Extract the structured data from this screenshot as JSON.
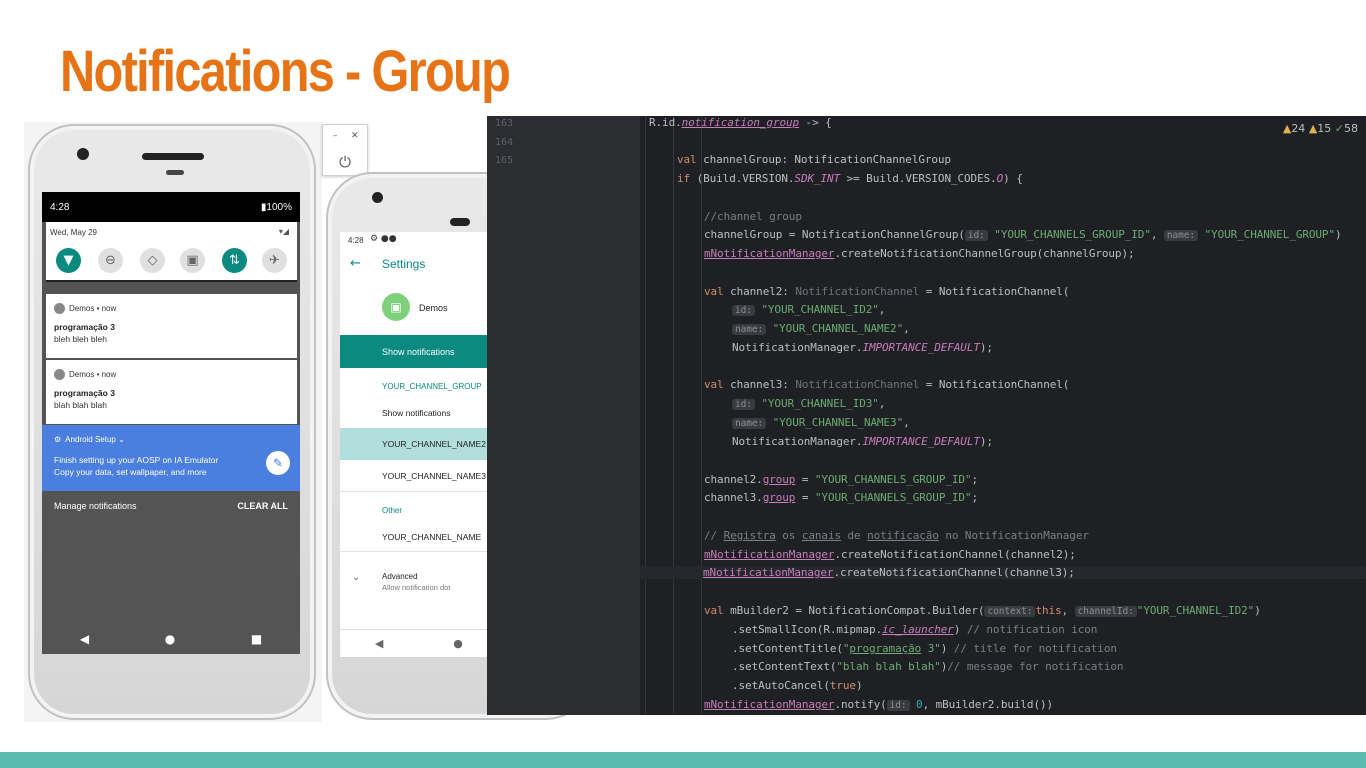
{
  "slide": {
    "title": "Notifications - Group",
    "colors": {
      "title": "#e67417",
      "bottom_bar": "#5bbbb0"
    }
  },
  "phone1": {
    "time": "4:28",
    "battery": "100%",
    "date": "Wed, May 29",
    "notifications": [
      {
        "app": "Demos • now",
        "title": "programação 3",
        "body": "bleh bleh bleh"
      },
      {
        "app": "Demos • now",
        "title": "programação 3",
        "body": "blah blah blah"
      }
    ],
    "setup": {
      "app": "Android Setup ⌄",
      "title": "Finish setting up your AOSP on IA Emulator",
      "body": "Copy your data, set wallpaper, and more"
    },
    "manage": "Manage notifications",
    "clear_all": "CLEAR ALL"
  },
  "phone2": {
    "time": "4:28",
    "title": "Settings",
    "app_name": "Demos",
    "show_notifications_header": "Show notifications",
    "group_header": "YOUR_CHANNEL_GROUP",
    "group_show": "Show notifications",
    "channel2": "YOUR_CHANNEL_NAME2",
    "channel3": "YOUR_CHANNEL_NAME3",
    "other_header": "Other",
    "channel": "YOUR_CHANNEL_NAME",
    "advanced": "Advanced",
    "advanced_sub": "Allow notification dot",
    "accent": "#0a8a80"
  },
  "editor": {
    "line_numbers": [
      "163",
      "164",
      "165"
    ],
    "warnings": {
      "warn_a": "24",
      "warn_b": "15",
      "ok": "58"
    },
    "code": {
      "l1a": "R.id.",
      "l1b": "notification_group",
      "l1c": " -> {",
      "l2a": "val ",
      "l2b": "channelGroup: NotificationChannelGroup",
      "l3a": "if ",
      "l3b": "(Build.VERSION.",
      "l3c": "SDK_INT",
      "l3d": " >= Build.VERSION_CODES.",
      "l3e": "O",
      "l3f": ") {",
      "l4": "//channel group",
      "l5a": "channelGroup = NotificationChannelGroup(",
      "l5h1": "id:",
      "l5b": "\"YOUR_CHANNELS_GROUP_ID\"",
      "l5c": ", ",
      "l5h2": "name:",
      "l5d": "\"YOUR_CHANNEL_GROUP\"",
      "l5e": ")",
      "l6a": "mNotificationManager",
      "l6b": ".createNotificationChannelGroup(channelGroup);",
      "l7a": "val ",
      "l7b": "channel2: ",
      "l7c": "NotificationChannel",
      "l7d": " = NotificationChannel(",
      "l8h": "id:",
      "l8b": "\"YOUR_CHANNEL_ID2\"",
      "l8c": ",",
      "l9h": "name:",
      "l9b": "\"YOUR_CHANNEL_NAME2\"",
      "l9c": ",",
      "l10a": "NotificationManager.",
      "l10b": "IMPORTANCE_DEFAULT",
      "l10c": ");",
      "l11a": "val ",
      "l11b": "channel3: ",
      "l11c": "NotificationChannel",
      "l11d": " = NotificationChannel(",
      "l12h": "id:",
      "l12b": "\"YOUR_CHANNEL_ID3\"",
      "l12c": ",",
      "l13h": "name:",
      "l13b": "\"YOUR_CHANNEL_NAME3\"",
      "l13c": ",",
      "l14a": "NotificationManager.",
      "l14b": "IMPORTANCE_DEFAULT",
      "l14c": ");",
      "l15a": "channel2.",
      "l15b": "group",
      "l15c": " = ",
      "l15d": "\"YOUR_CHANNELS_GROUP_ID\"",
      "l15e": ";",
      "l16a": "channel3.",
      "l16b": "group",
      "l16c": " = ",
      "l16d": "\"YOUR_CHANNELS_GROUP_ID\"",
      "l16e": ";",
      "l17a": "// ",
      "l17b": "Registra",
      "l17c": " os ",
      "l17d": "canais",
      "l17e": " de ",
      "l17f": "notificação",
      "l17g": " no NotificationManager",
      "l18a": "mNotificationManager",
      "l18b": ".createNotificationChannel(channel2);",
      "l19a": "mNotificationManager",
      "l19b": ".createNotificationChannel(channel3);",
      "l20a": "val ",
      "l20b": "mBuilder2 = NotificationCompat.Builder(",
      "l20h1": "context:",
      "l20c": "this",
      "l20d": ", ",
      "l20h2": "channelId:",
      "l20e": "\"YOUR_CHANNEL_ID2\"",
      "l20f": ")",
      "l21a": ".setSmallIcon(R.mipmap.",
      "l21b": "ic_launcher",
      "l21c": ") ",
      "l21d": "// notification icon",
      "l22a": ".setContentTitle(",
      "l22b": "\"",
      "l22c": "programação",
      "l22d": " 3\"",
      "l22e": ") ",
      "l22f": "// title for notification",
      "l23a": ".setContentText(",
      "l23b": "\"blah blah blah\"",
      "l23c": ")",
      "l23d": "// message for notification",
      "l24a": ".setAutoCancel(",
      "l24b": "true",
      "l24c": ")",
      "l25a": "mNotificationManager",
      "l25b": ".notify(",
      "l25h": "id:",
      "l25c": "0",
      "l25d": ", mBuilder2.build())"
    },
    "colors": {
      "bg": "#1f2023",
      "keyword": "#cf8e6d",
      "string": "#6aab73",
      "field": "#c77dbb",
      "comment": "#7a7e85"
    }
  }
}
